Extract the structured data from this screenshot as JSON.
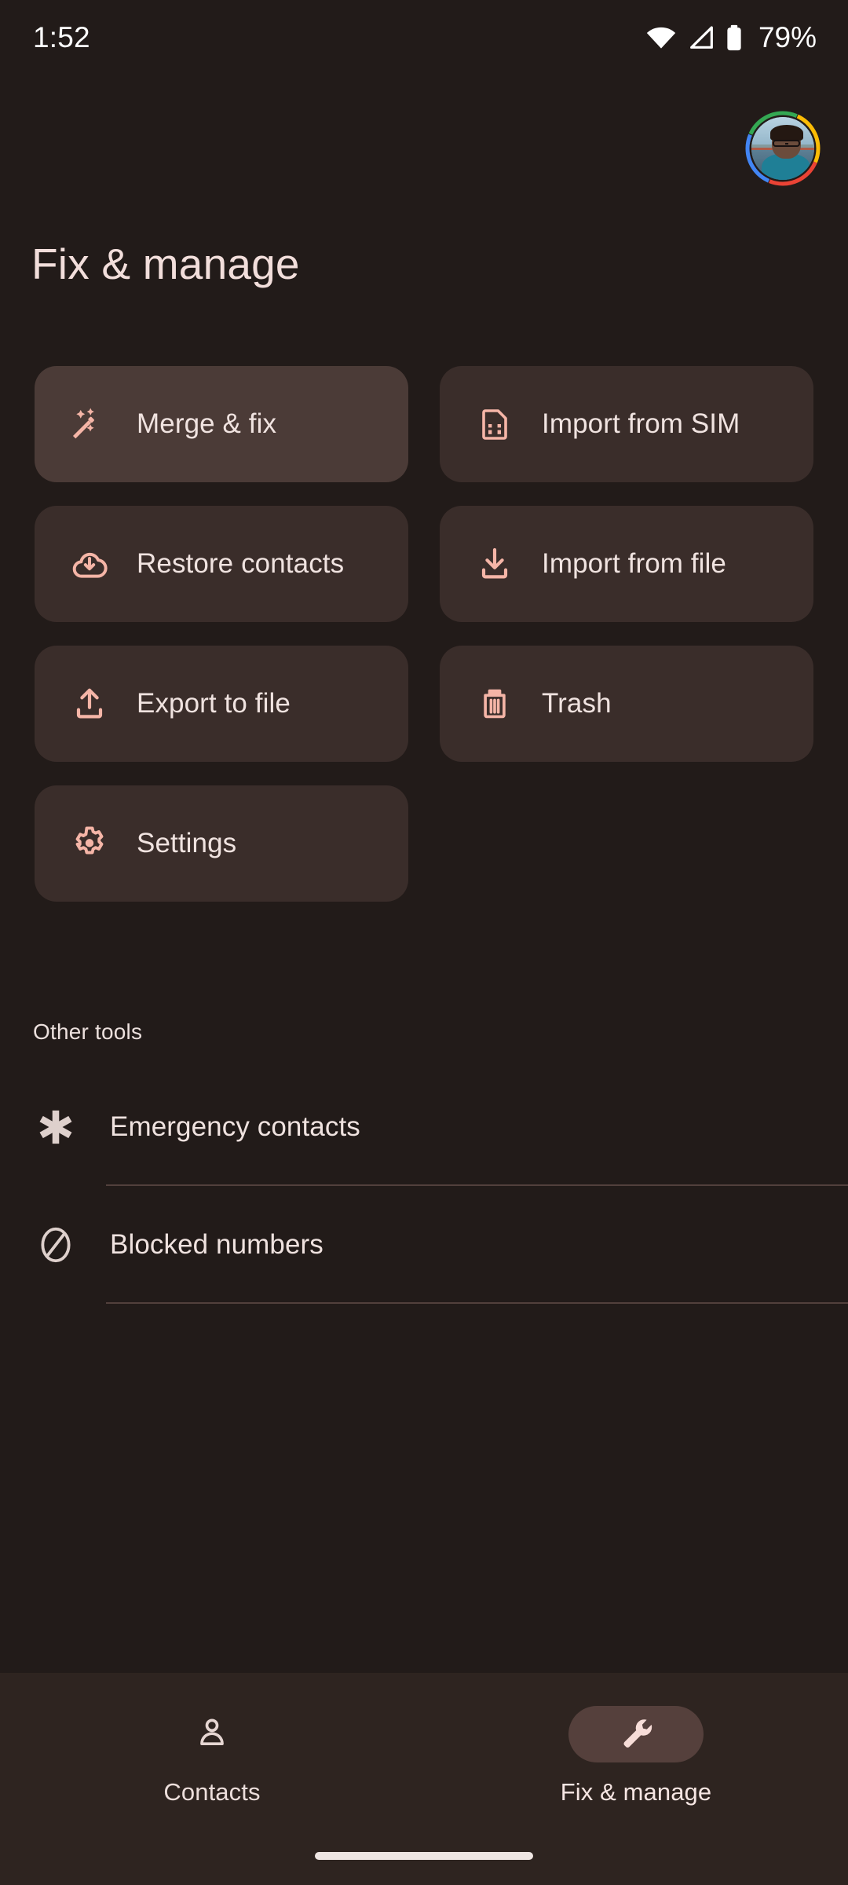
{
  "status_bar": {
    "time": "1:52",
    "battery_percent": "79%",
    "wifi_icon": "wifi-icon",
    "signal_icon": "cellular-signal-icon",
    "battery_icon": "battery-icon"
  },
  "account": {
    "avatar_icon": "account-avatar",
    "ring_colors": [
      "#ea4335",
      "#4285f4",
      "#34a853",
      "#fbbc05"
    ]
  },
  "header": {
    "title": "Fix & manage"
  },
  "colors": {
    "background": "#221b19",
    "card": "#3a2d2a",
    "card_highlight": "#4b3b37",
    "accent": "#f5b5a7",
    "text_primary": "#f0e3e0",
    "title": "#f2dedb",
    "nav_bar": "#2e2420",
    "nav_pill_active": "#55403c",
    "divider": "#52403c"
  },
  "main": {
    "cards": [
      {
        "label": "Merge & fix",
        "icon": "magic-wand-icon",
        "highlight": true
      },
      {
        "label": "Import from SIM",
        "icon": "sim-card-icon",
        "highlight": false
      },
      {
        "label": "Restore contacts",
        "icon": "cloud-download-icon",
        "highlight": false
      },
      {
        "label": "Import from file",
        "icon": "file-download-icon",
        "highlight": false
      },
      {
        "label": "Export to file",
        "icon": "file-upload-icon",
        "highlight": false
      },
      {
        "label": "Trash",
        "icon": "trash-icon",
        "highlight": false
      },
      {
        "label": "Settings",
        "icon": "gear-icon",
        "highlight": false
      }
    ],
    "other_tools": {
      "heading": "Other tools",
      "items": [
        {
          "label": "Emergency contacts",
          "icon": "star-of-life-icon"
        },
        {
          "label": "Blocked numbers",
          "icon": "block-circle-icon"
        }
      ]
    }
  },
  "bottom_nav": {
    "items": [
      {
        "label": "Contacts",
        "icon": "person-icon",
        "active": false
      },
      {
        "label": "Fix & manage",
        "icon": "wrench-icon",
        "active": true
      }
    ]
  }
}
